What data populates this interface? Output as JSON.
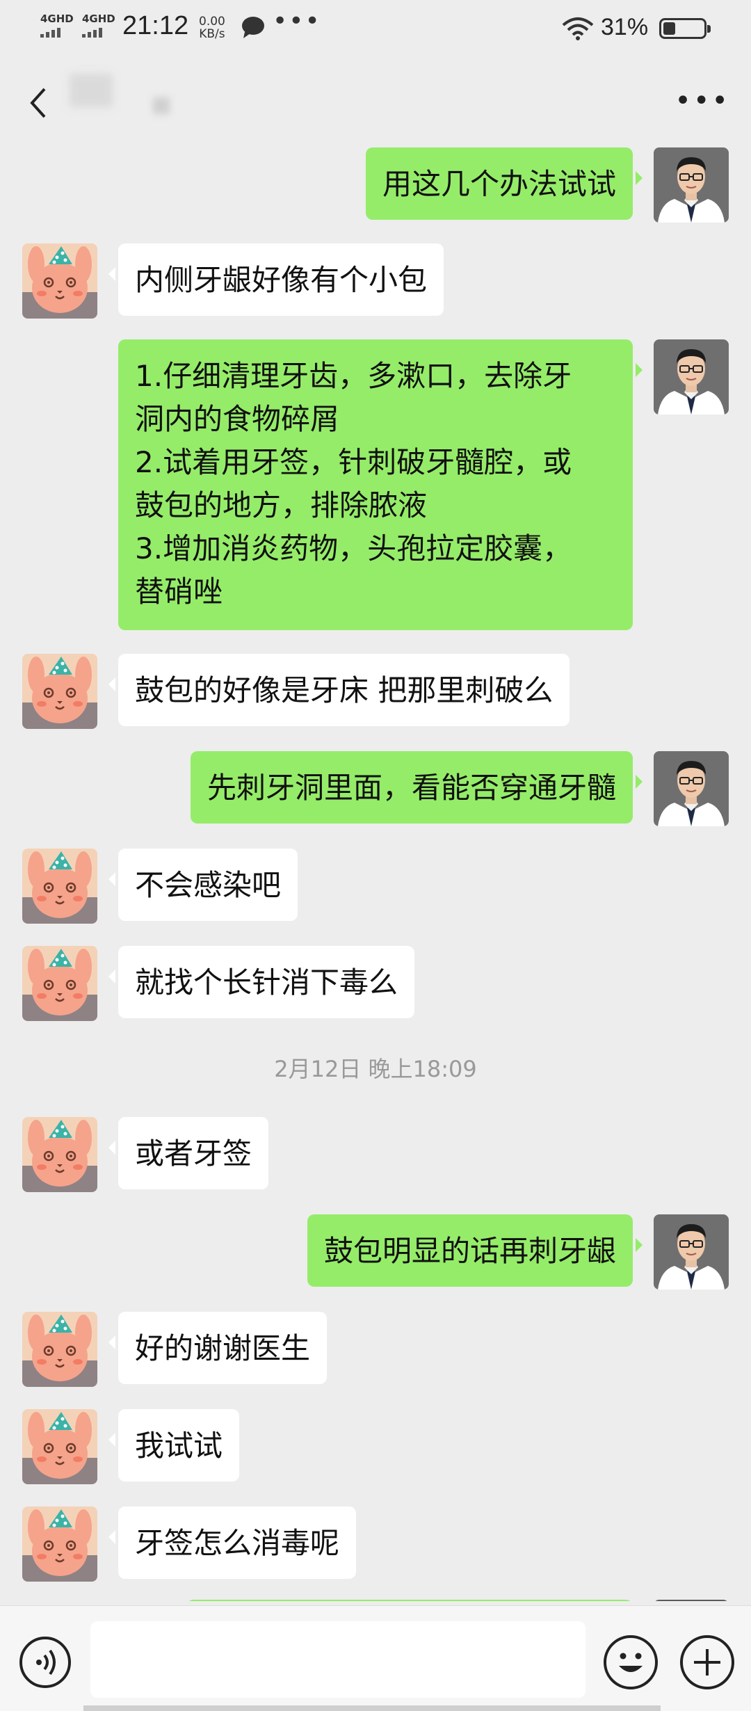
{
  "status_bar": {
    "network_1": "4GHD",
    "network_2": "4GHD",
    "time": "21:12",
    "speed_value": "0.00",
    "speed_unit": "KB/s",
    "more_dots": "•••",
    "battery_percent": "31%",
    "battery_level": 0.31
  },
  "title_bar": {
    "back_icon": "chevron-left-icon",
    "more_label": "•••"
  },
  "colors": {
    "background": "#ededed",
    "incoming_bubble": "#ffffff",
    "outgoing_bubble": "#95ec69",
    "timestamp_text": "#999999"
  },
  "messages": [
    {
      "from": "doctor",
      "text": "用这几个办法试试"
    },
    {
      "from": "patient",
      "text": "内侧牙龈好像有个小包"
    },
    {
      "from": "doctor",
      "text": "1.仔细清理牙齿，多漱口，去除牙\n洞内的食物碎屑\n2.试着用牙签，针刺破牙髓腔，或\n鼓包的地方，排除脓液\n3.增加消炎药物，头孢拉定胶囊，\n替硝唑"
    },
    {
      "from": "patient",
      "text": "鼓包的好像是牙床 把那里刺破么"
    },
    {
      "from": "doctor",
      "text": "先刺牙洞里面，看能否穿通牙髓"
    },
    {
      "from": "patient",
      "text": "不会感染吧"
    },
    {
      "from": "patient",
      "text": "就找个长针消下毒么"
    },
    {
      "from": "system",
      "text": "2月12日 晚上18:09"
    },
    {
      "from": "patient",
      "text": "或者牙签"
    },
    {
      "from": "doctor",
      "text": "鼓包明显的话再刺牙龈"
    },
    {
      "from": "patient",
      "text": "好的谢谢医生"
    },
    {
      "from": "patient",
      "text": "我试试"
    },
    {
      "from": "patient",
      "text": "牙签怎么消毒呢"
    }
  ],
  "input_bar": {
    "voice_icon": "voice-icon",
    "emoji_icon": "emoji-icon",
    "plus_icon": "plus-icon"
  }
}
